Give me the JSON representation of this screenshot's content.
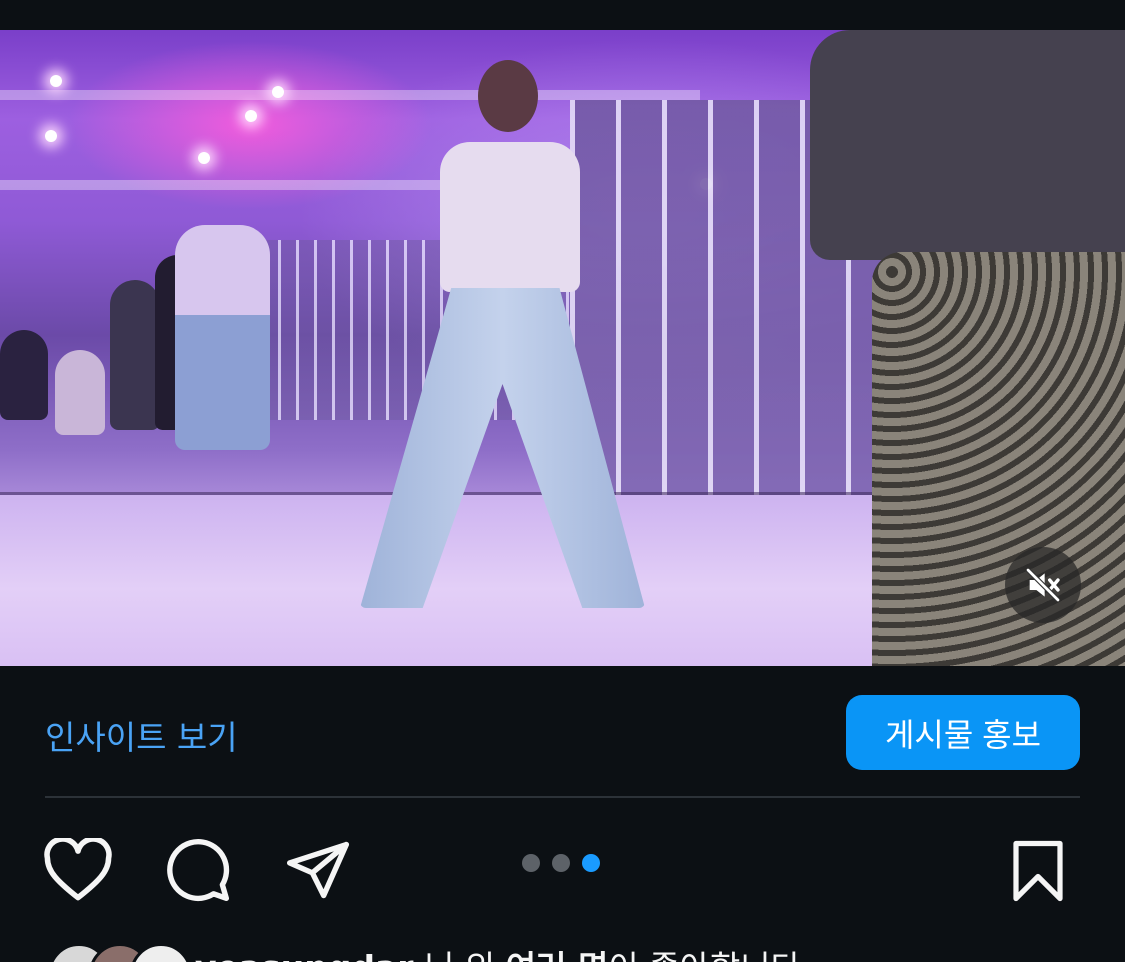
{
  "post": {
    "media_alt": "dance practice video",
    "carousel": {
      "count": 3,
      "active_index": 2
    }
  },
  "insights": {
    "link_label": "인사이트 보기",
    "promote_label": "게시물 홍보"
  },
  "actions": {
    "like": "heart-icon",
    "comment": "comment-icon",
    "share": "send-icon",
    "save": "bookmark-icon",
    "mute": "speaker-muted-icon"
  },
  "likes": {
    "username": "yeasungdar",
    "connector": "님 외",
    "others": "여러 명",
    "suffix": "이 좋아합니다"
  },
  "colors": {
    "background": "#0c1014",
    "accent": "#0a95f6",
    "link": "#4aa3f5",
    "dot_inactive": "#5d6268"
  }
}
